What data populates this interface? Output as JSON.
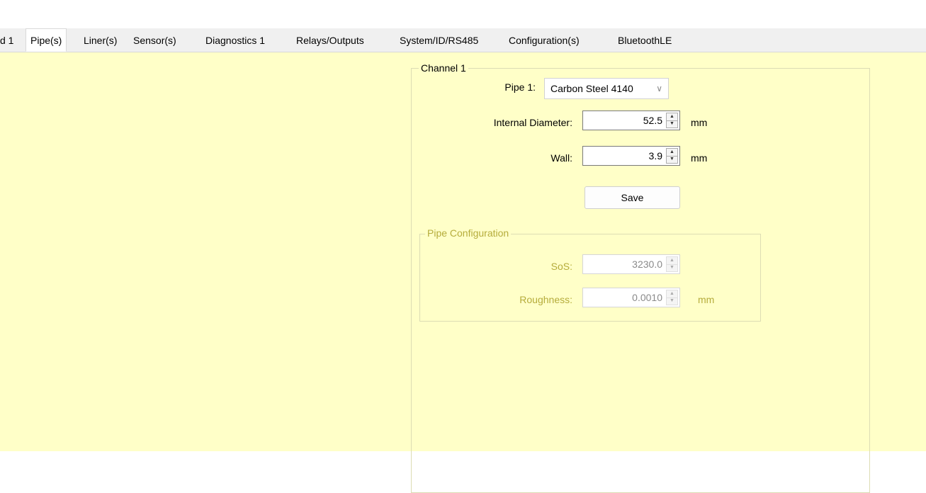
{
  "tabs": [
    {
      "label": "d 1",
      "active": false
    },
    {
      "label": "Pipe(s)",
      "active": true
    },
    {
      "label": "Liner(s)",
      "active": false
    },
    {
      "label": "Sensor(s)",
      "active": false
    },
    {
      "label": "Diagnostics 1",
      "active": false
    },
    {
      "label": "Relays/Outputs",
      "active": false
    },
    {
      "label": "System/ID/RS485",
      "active": false
    },
    {
      "label": "Configuration(s)",
      "active": false
    },
    {
      "label": "BluetoothLE",
      "active": false
    }
  ],
  "channel": {
    "title": "Channel 1",
    "pipe_label": "Pipe 1:",
    "pipe_value": "Carbon Steel 4140",
    "internal_diameter_label": "Internal Diameter:",
    "internal_diameter_value": "52.5",
    "internal_diameter_unit": "mm",
    "wall_label": "Wall:",
    "wall_value": "3.9",
    "wall_unit": "mm",
    "save_label": "Save"
  },
  "pipe_config": {
    "title": "Pipe Configuration",
    "sos_label": "SoS:",
    "sos_value": "3230.0",
    "roughness_label": "Roughness:",
    "roughness_value": "0.0010",
    "roughness_unit": "mm"
  },
  "colors": {
    "panel_background": "#ffffc8",
    "disabled_label": "#b5ac3b",
    "tab_bar": "#f0f0f0"
  },
  "icons": {
    "dropdown": "chevron-down-icon",
    "spin_up": "arrow-up-icon",
    "spin_down": "arrow-down-icon"
  }
}
